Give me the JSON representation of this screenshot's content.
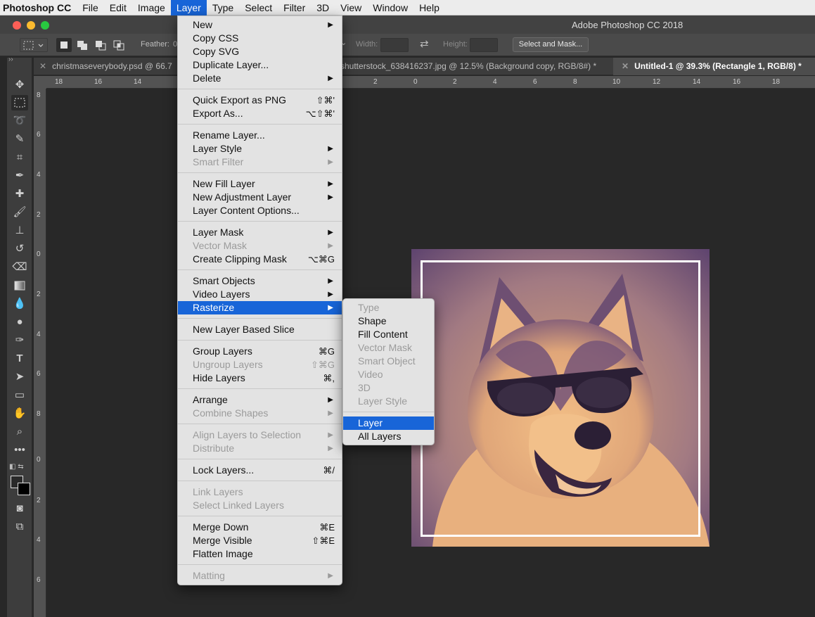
{
  "menubar": {
    "app": "Photoshop CC",
    "items": [
      "File",
      "Edit",
      "Image",
      "Layer",
      "Type",
      "Select",
      "Filter",
      "3D",
      "View",
      "Window",
      "Help"
    ],
    "active_index": 3
  },
  "window": {
    "title": "Adobe Photoshop CC 2018"
  },
  "options_bar": {
    "feather_label": "Feather:",
    "feather_value": "0",
    "width_label": "Width:",
    "height_label": "Height:",
    "select_mask_button": "Select and Mask..."
  },
  "tabs": [
    {
      "label": "christmaseverybody.psd @ 66.7",
      "active": false
    },
    {
      "label": "shutterstock_638416237.jpg @ 12.5% (Background copy, RGB/8#) *",
      "active": false
    },
    {
      "label": "Untitled-1 @ 39.3% (Rectangle 1, RGB/8) *",
      "active": true
    }
  ],
  "rulers": {
    "horizontal": [
      "18",
      "16",
      "14",
      "2",
      "0",
      "2",
      "4",
      "6",
      "8",
      "10",
      "12",
      "14",
      "16",
      "18"
    ],
    "vertical": [
      "8",
      "6",
      "4",
      "2",
      "0",
      "2",
      "4",
      "6",
      "8",
      "0",
      "2",
      "4",
      "6"
    ]
  },
  "layer_menu": {
    "groups": [
      [
        {
          "label": "New",
          "submenu": true
        },
        {
          "label": "Copy CSS"
        },
        {
          "label": "Copy SVG"
        },
        {
          "label": "Duplicate Layer..."
        },
        {
          "label": "Delete",
          "submenu": true
        }
      ],
      [
        {
          "label": "Quick Export as PNG",
          "shortcut": "⇧⌘'"
        },
        {
          "label": "Export As...",
          "shortcut": "⌥⇧⌘'"
        }
      ],
      [
        {
          "label": "Rename Layer..."
        },
        {
          "label": "Layer Style",
          "submenu": true
        },
        {
          "label": "Smart Filter",
          "submenu": true,
          "disabled": true
        }
      ],
      [
        {
          "label": "New Fill Layer",
          "submenu": true
        },
        {
          "label": "New Adjustment Layer",
          "submenu": true
        },
        {
          "label": "Layer Content Options..."
        }
      ],
      [
        {
          "label": "Layer Mask",
          "submenu": true
        },
        {
          "label": "Vector Mask",
          "submenu": true,
          "disabled": true
        },
        {
          "label": "Create Clipping Mask",
          "shortcut": "⌥⌘G"
        }
      ],
      [
        {
          "label": "Smart Objects",
          "submenu": true
        },
        {
          "label": "Video Layers",
          "submenu": true
        },
        {
          "label": "Rasterize",
          "submenu": true,
          "highlighted": true
        }
      ],
      [
        {
          "label": "New Layer Based Slice"
        }
      ],
      [
        {
          "label": "Group Layers",
          "shortcut": "⌘G"
        },
        {
          "label": "Ungroup Layers",
          "shortcut": "⇧⌘G",
          "disabled": true
        },
        {
          "label": "Hide Layers",
          "shortcut": "⌘,"
        }
      ],
      [
        {
          "label": "Arrange",
          "submenu": true
        },
        {
          "label": "Combine Shapes",
          "submenu": true,
          "disabled": true
        }
      ],
      [
        {
          "label": "Align Layers to Selection",
          "submenu": true,
          "disabled": true
        },
        {
          "label": "Distribute",
          "submenu": true,
          "disabled": true
        }
      ],
      [
        {
          "label": "Lock Layers...",
          "shortcut": "⌘/"
        }
      ],
      [
        {
          "label": "Link Layers",
          "disabled": true
        },
        {
          "label": "Select Linked Layers",
          "disabled": true
        }
      ],
      [
        {
          "label": "Merge Down",
          "shortcut": "⌘E"
        },
        {
          "label": "Merge Visible",
          "shortcut": "⇧⌘E"
        },
        {
          "label": "Flatten Image"
        }
      ],
      [
        {
          "label": "Matting",
          "submenu": true,
          "disabled": true
        }
      ]
    ]
  },
  "rasterize_submenu": {
    "groups": [
      [
        {
          "label": "Type",
          "disabled": true
        },
        {
          "label": "Shape"
        },
        {
          "label": "Fill Content"
        },
        {
          "label": "Vector Mask",
          "disabled": true
        },
        {
          "label": "Smart Object",
          "disabled": true
        },
        {
          "label": "Video",
          "disabled": true
        },
        {
          "label": "3D",
          "disabled": true
        },
        {
          "label": "Layer Style",
          "disabled": true
        }
      ],
      [
        {
          "label": "Layer",
          "highlighted": true
        },
        {
          "label": "All Layers"
        }
      ]
    ]
  },
  "toolbar": {
    "tools": [
      "move-tool-icon",
      "rectangular-marquee-icon",
      "lasso-icon",
      "quick-select-icon",
      "crop-icon",
      "eyedropper-icon",
      "healing-brush-icon",
      "brush-icon",
      "clone-stamp-icon",
      "history-brush-icon",
      "eraser-icon",
      "gradient-icon",
      "blur-icon",
      "dodge-icon",
      "pen-icon",
      "type-icon",
      "path-select-icon",
      "rectangle-icon",
      "hand-icon",
      "zoom-icon",
      "more-tools-icon"
    ],
    "selected_index": 1,
    "foreground_color": "#2a2a2a",
    "background_color": "#000000"
  },
  "colors": {
    "menu_highlight": "#1865d8",
    "menu_bg": "#e3e3e3",
    "canvas_bg": "#282828",
    "artwork_light": "#eab27a",
    "artwork_dark": "#5a3f6b"
  }
}
